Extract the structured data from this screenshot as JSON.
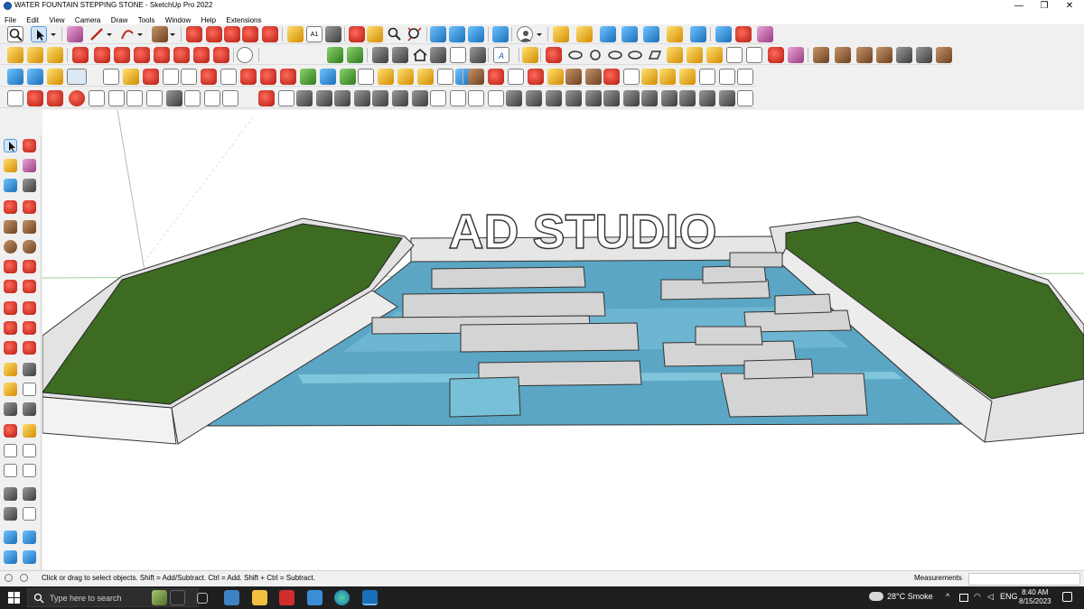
{
  "window": {
    "title": "WATER FOUNTAIN STEPPING STONE - SketchUp Pro 2022",
    "minimize_glyph": "—",
    "restore_glyph": "❐",
    "close_glyph": "✕"
  },
  "menu": {
    "items": [
      {
        "label": "File"
      },
      {
        "label": "Edit"
      },
      {
        "label": "View"
      },
      {
        "label": "Camera"
      },
      {
        "label": "Draw"
      },
      {
        "label": "Tools"
      },
      {
        "label": "Window"
      },
      {
        "label": "Help"
      },
      {
        "label": "Extensions"
      }
    ]
  },
  "toolbar": {
    "text_tool_badge": "A1",
    "style_badge": "A"
  },
  "viewport": {
    "model_text": "AD STUDIO",
    "colors": {
      "grass": "#3d6b22",
      "water": "#5ba6c4",
      "stone": "#d4d4d4",
      "wall": "#e6e6e6"
    }
  },
  "statusbar": {
    "hint": "Click or drag to select objects. Shift = Add/Subtract. Ctrl = Add. Shift + Ctrl = Subtract.",
    "measurements_label": "Measurements",
    "measurements_value": ""
  },
  "taskbar": {
    "search_placeholder": "Type here to search",
    "weather": "28°C  Smoke",
    "language": "ENG",
    "time": "8:40 AM",
    "date": "8/15/2023"
  }
}
